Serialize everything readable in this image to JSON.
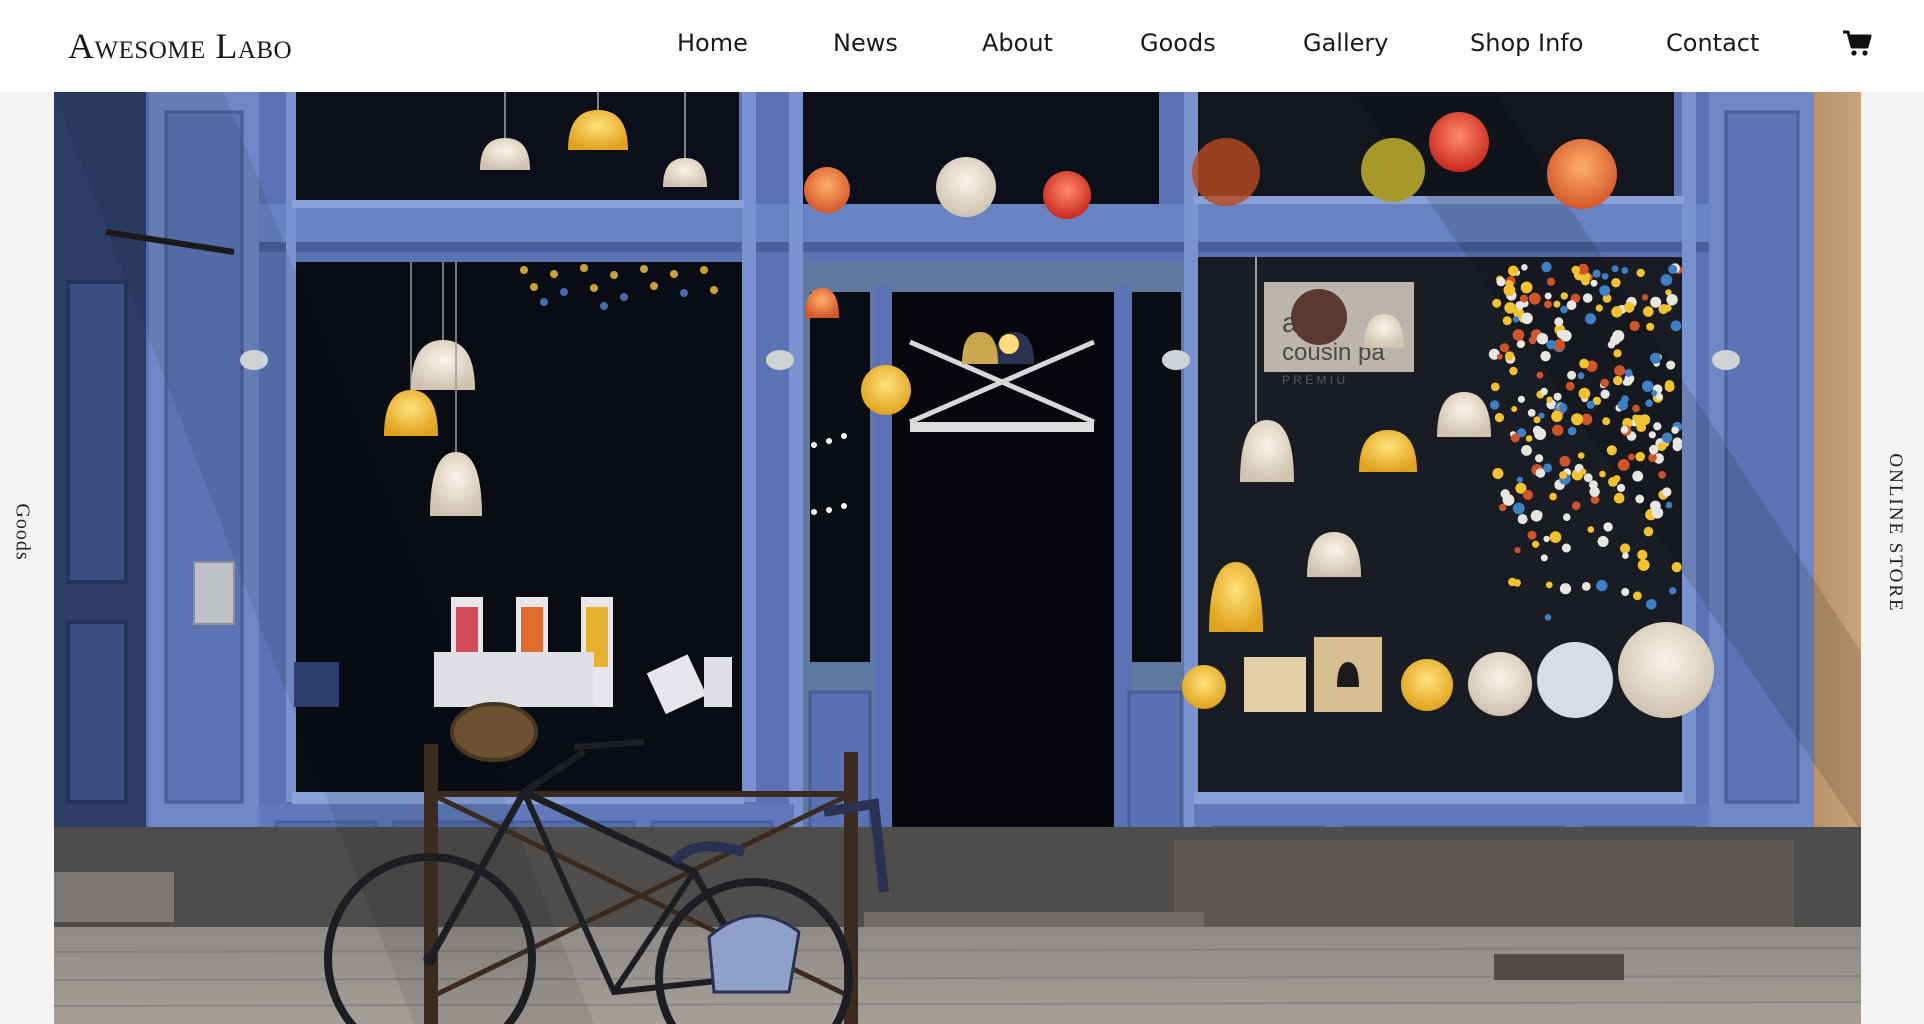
{
  "header": {
    "logo": "Awesome Labo"
  },
  "nav": {
    "items": [
      {
        "label": "Home"
      },
      {
        "label": "News"
      },
      {
        "label": "About"
      },
      {
        "label": "Goods"
      },
      {
        "label": "Gallery"
      },
      {
        "label": "Shop Info"
      },
      {
        "label": "Contact"
      }
    ],
    "cart_icon": "cart-icon"
  },
  "side": {
    "left_label": "Goods",
    "right_label": "ONLINE STORE"
  },
  "hero": {
    "description_icon": "storefront-photo",
    "sign_text_1": "ase",
    "sign_text_2": "cousin pa",
    "sign_text_3": "P R E M I U"
  },
  "colors": {
    "header_bg": "#ffffff",
    "page_bg": "#f4f4f4",
    "storefront_blue": "#5a74b8",
    "text": "#1a1a1a"
  }
}
